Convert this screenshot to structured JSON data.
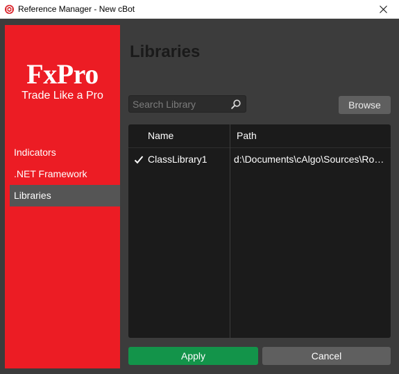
{
  "window": {
    "title": "Reference Manager - New cBot",
    "app_icon": "calgo-app-icon",
    "close_icon": "close-icon"
  },
  "sidebar": {
    "brand_logo": "FxPro",
    "brand_tagline": "Trade Like a Pro",
    "items": [
      {
        "label": "Indicators",
        "active": false
      },
      {
        "label": ".NET Framework",
        "active": false
      },
      {
        "label": "Libraries",
        "active": true
      }
    ],
    "color": "#ec1c24"
  },
  "main": {
    "title": "Libraries",
    "search": {
      "placeholder": "Search Library",
      "value": "",
      "icon": "search-icon"
    },
    "browse_label": "Browse",
    "table": {
      "columns": [
        "Name",
        "Path"
      ],
      "rows": [
        {
          "checked": true,
          "name": "ClassLibrary1",
          "path": "d:\\Documents\\cAlgo\\Sources\\Ro…"
        }
      ]
    },
    "apply_label": "Apply",
    "cancel_label": "Cancel"
  },
  "colors": {
    "background": "#3c3c3c",
    "apply": "#13944a",
    "secondary_button": "#5f5f5f",
    "table_bg": "#1b1b1b"
  }
}
